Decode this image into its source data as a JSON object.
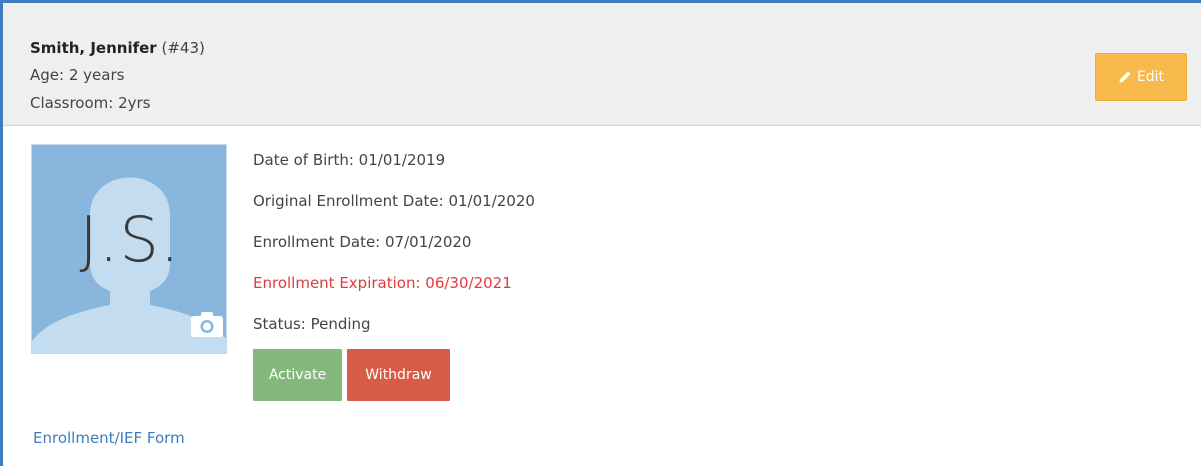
{
  "header": {
    "name": "Smith, Jennifer",
    "id": "(#43)",
    "age": "Age: 2 years",
    "classroom": "Classroom: 2yrs",
    "edit_label": "Edit"
  },
  "photo": {
    "initials": "J.S."
  },
  "details": {
    "dob": "Date of Birth: 01/01/2019",
    "original_enrollment": "Original Enrollment Date: 01/01/2020",
    "enrollment": "Enrollment Date: 07/01/2020",
    "expiration": "Enrollment Expiration: 06/30/2021",
    "status": "Status: Pending"
  },
  "actions": {
    "activate_label": "Activate",
    "withdraw_label": "Withdraw"
  },
  "links": {
    "form_label": "Enrollment/IEF Form"
  },
  "colors": {
    "accent": "#3c7ebf",
    "edit": "#f7b94b",
    "activate": "#85b87d",
    "withdraw": "#d65c47",
    "expiration_text": "#e23b3b"
  }
}
